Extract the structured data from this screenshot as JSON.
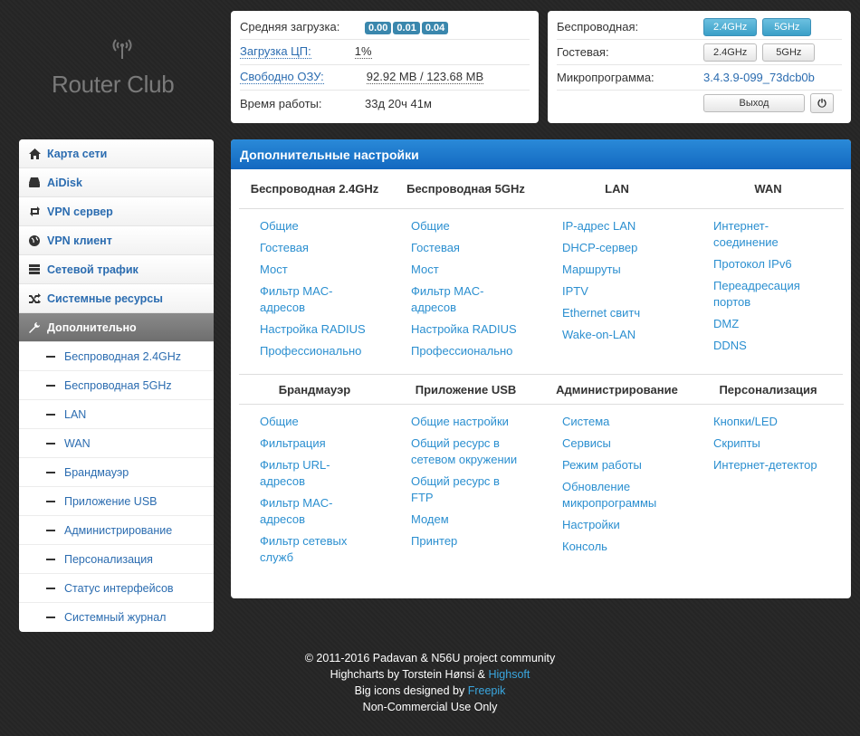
{
  "logo": {
    "text": "Router Club"
  },
  "status": {
    "load_label": "Средняя загрузка:",
    "load_values": [
      "0.00",
      "0.01",
      "0.04"
    ],
    "cpu_label": "Загрузка ЦП:",
    "cpu_value": "1%",
    "ram_label": "Свободно ОЗУ:",
    "ram_value": "92.92 MB / 123.68 MB",
    "uptime_label": "Время работы:",
    "uptime_value": "33д 20ч 41м"
  },
  "info": {
    "wireless_label": "Беспроводная:",
    "guest_label": "Гостевая:",
    "btn_24": "2.4GHz",
    "btn_5": "5GHz",
    "firmware_label": "Микропрограмма:",
    "firmware_value": "3.4.3.9-099_73dcb0b",
    "logout_label": "Выход",
    "power_glyph": "⏻"
  },
  "sidebar": {
    "items": [
      {
        "label": "Карта сети",
        "icon": "home-icon"
      },
      {
        "label": "AiDisk",
        "icon": "hdd-icon"
      },
      {
        "label": "VPN сервер",
        "icon": "retweet-icon"
      },
      {
        "label": "VPN клиент",
        "icon": "globe-icon"
      },
      {
        "label": "Сетевой трафик",
        "icon": "tasks-icon"
      },
      {
        "label": "Системные ресурсы",
        "icon": "random-icon"
      },
      {
        "label": "Дополнительно",
        "icon": "wrench-icon"
      }
    ],
    "subitems": [
      "Беспроводная 2.4GHz",
      "Беспроводная 5GHz",
      "LAN",
      "WAN",
      "Брандмауэр",
      "Приложение USB",
      "Администрирование",
      "Персонализация",
      "Статус интерфейсов",
      "Системный журнал"
    ]
  },
  "main": {
    "title": "Дополнительные настройки",
    "sections": [
      {
        "columns": [
          {
            "title": "Беспроводная 2.4GHz",
            "links": [
              "Общие",
              "Гостевая",
              "Мост",
              "Фильтр MAC-адресов",
              "Настройка RADIUS",
              "Профессионально"
            ]
          },
          {
            "title": "Беспроводная 5GHz",
            "links": [
              "Общие",
              "Гостевая",
              "Мост",
              "Фильтр MAC-адресов",
              "Настройка RADIUS",
              "Профессионально"
            ]
          },
          {
            "title": "LAN",
            "links": [
              "IP-адрес LAN",
              "DHCP-сервер",
              "Маршруты",
              "IPTV",
              "Ethernet свитч",
              "Wake-on-LAN"
            ]
          },
          {
            "title": "WAN",
            "links": [
              "Интернет-соединение",
              "Протокол IPv6",
              "Переадресация портов",
              "DMZ",
              "DDNS"
            ]
          }
        ]
      },
      {
        "columns": [
          {
            "title": "Брандмауэр",
            "links": [
              "Общие",
              "Фильтрация",
              "Фильтр URL-адресов",
              "Фильтр MAC-адресов",
              "Фильтр сетевых служб"
            ]
          },
          {
            "title": "Приложение USB",
            "links": [
              "Общие настройки",
              "Общий ресурс в сетевом окружении",
              "Общий ресурс в FTP",
              "Модем",
              "Принтер"
            ]
          },
          {
            "title": "Администрирование",
            "links": [
              "Система",
              "Сервисы",
              "Режим работы",
              "Обновление микропрограммы",
              "Настройки",
              "Консоль"
            ]
          },
          {
            "title": "Персонализация",
            "links": [
              "Кнопки/LED",
              "Скрипты",
              "Интернет-детектор"
            ]
          }
        ]
      }
    ]
  },
  "footer": {
    "line1": "© 2011-2016 Padavan & N56U project community",
    "line2_prefix": "Highcharts by Torstein Hønsi & ",
    "line2_link": "Highsoft",
    "line3_prefix": "Big icons designed by ",
    "line3_link": "Freepik",
    "line4": "Non-Commercial Use Only"
  },
  "colors": {
    "accent": "#1b78cc",
    "link": "#2b8fd0",
    "badge": "#3a87ad"
  }
}
